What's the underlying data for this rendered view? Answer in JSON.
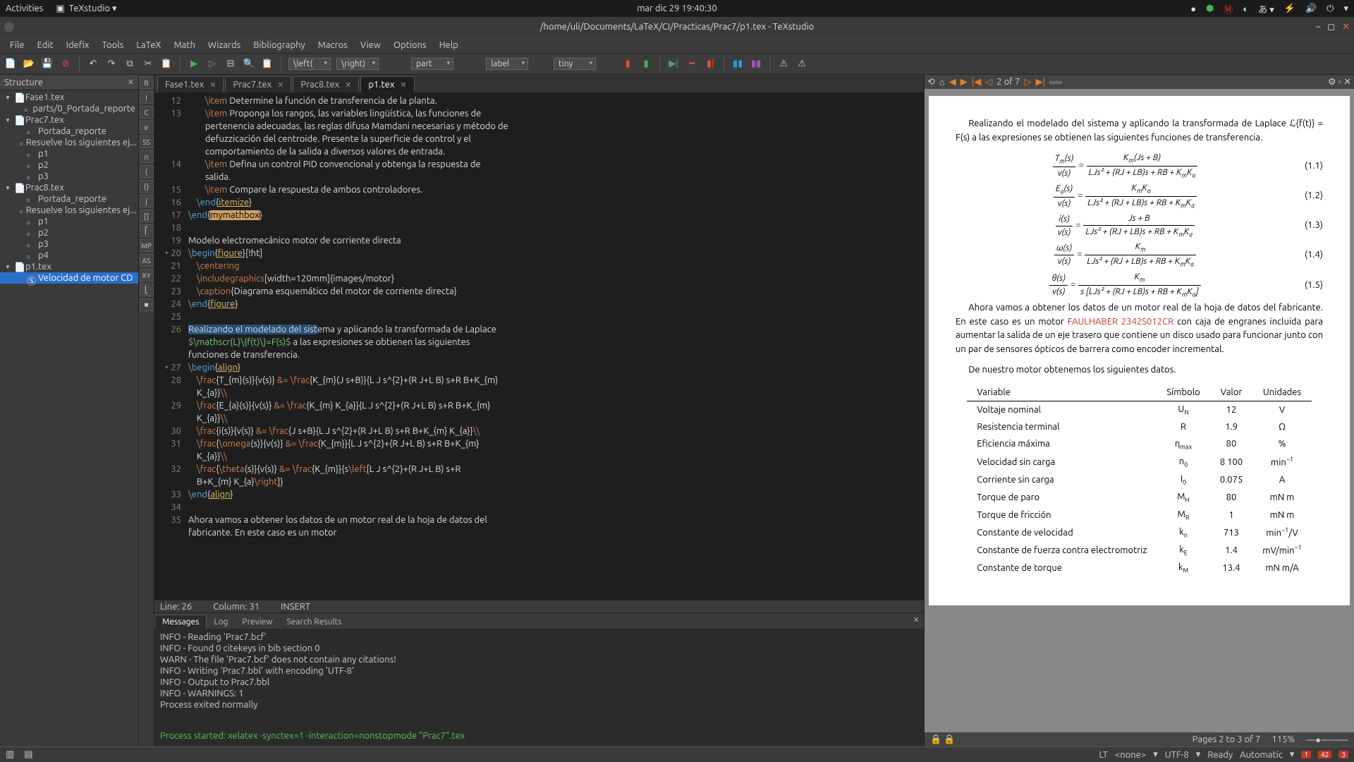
{
  "topbar": {
    "activities": "Activities",
    "app": "TeXstudio",
    "clock": "mar dic 29  19:40:30"
  },
  "titlebar": {
    "path": "/home/uli/Documents/LaTeX/CI/Practicas/Prac7/p1.tex - TeXstudio"
  },
  "menus": [
    "File",
    "Edit",
    "Idefix",
    "Tools",
    "LaTeX",
    "Math",
    "Wizards",
    "Bibliography",
    "Macros",
    "View",
    "Options",
    "Help"
  ],
  "combos": {
    "left": "\\left(",
    "right": "\\right)",
    "part": "part",
    "label": "label",
    "tiny": "tiny"
  },
  "structure": {
    "title": "Structure",
    "tree": [
      {
        "d": 0,
        "t": "▾",
        "label": "Fase1.tex"
      },
      {
        "d": 1,
        "t": "",
        "label": "parts/0_Portada_reporte"
      },
      {
        "d": 0,
        "t": "▾",
        "label": "Prac7.tex"
      },
      {
        "d": 1,
        "t": "",
        "label": "Portada_reporte"
      },
      {
        "d": 1,
        "t": "",
        "label": "Resuelve los siguientes ej..."
      },
      {
        "d": 1,
        "t": "",
        "label": "p1"
      },
      {
        "d": 1,
        "t": "",
        "label": "p2"
      },
      {
        "d": 1,
        "t": "",
        "label": "p3"
      },
      {
        "d": 0,
        "t": "▾",
        "label": "Prac8.tex"
      },
      {
        "d": 1,
        "t": "",
        "label": "Portada_reporte"
      },
      {
        "d": 1,
        "t": "",
        "label": "Resuelve los siguientes ej..."
      },
      {
        "d": 1,
        "t": "",
        "label": "p1"
      },
      {
        "d": 1,
        "t": "",
        "label": "p2"
      },
      {
        "d": 1,
        "t": "",
        "label": "p3"
      },
      {
        "d": 1,
        "t": "",
        "label": "p4"
      },
      {
        "d": 0,
        "t": "▾",
        "label": "p1.tex"
      },
      {
        "d": 1,
        "t": "",
        "label": "Velocidad de motor CD",
        "sel": true
      }
    ]
  },
  "side_icons": [
    "B",
    "I",
    "C",
    "e",
    "SS",
    "π",
    "(",
    "{}",
    "∫",
    "[]",
    "⎡",
    "MP",
    "AS",
    "XY",
    "⎣",
    "■"
  ],
  "tabs": [
    {
      "label": "Fase1.tex"
    },
    {
      "label": "Prac7.tex"
    },
    {
      "label": "Prac8.tex"
    },
    {
      "label": "p1.tex",
      "active": true
    }
  ],
  "gutter": [
    {
      "n": "12"
    },
    {
      "n": "13"
    },
    {
      "n": ""
    },
    {
      "n": ""
    },
    {
      "n": ""
    },
    {
      "n": "14"
    },
    {
      "n": ""
    },
    {
      "n": "15"
    },
    {
      "n": "16"
    },
    {
      "n": "17"
    },
    {
      "n": "18"
    },
    {
      "n": "19"
    },
    {
      "n": "20",
      "f": "▾"
    },
    {
      "n": "21"
    },
    {
      "n": "22"
    },
    {
      "n": "23"
    },
    {
      "n": "24"
    },
    {
      "n": "25"
    },
    {
      "n": "26"
    },
    {
      "n": ""
    },
    {
      "n": ""
    },
    {
      "n": "27",
      "f": "▾"
    },
    {
      "n": "28"
    },
    {
      "n": ""
    },
    {
      "n": "29"
    },
    {
      "n": ""
    },
    {
      "n": "30"
    },
    {
      "n": "31"
    },
    {
      "n": ""
    },
    {
      "n": "32"
    },
    {
      "n": ""
    },
    {
      "n": "33"
    },
    {
      "n": "34"
    },
    {
      "n": "35"
    },
    {
      "n": ""
    }
  ],
  "edstatus": {
    "line": "Line: 26",
    "col": "Column: 31",
    "mode": "INSERT"
  },
  "bottom": {
    "tabs": [
      "Messages",
      "Log",
      "Preview",
      "Search Results"
    ],
    "lines": [
      "INFO - Reading 'Prac7.bcf'",
      "INFO - Found 0 citekeys in bib section 0",
      "WARN - The file 'Prac7.bcf' does not contain any citations!",
      "INFO - Writing 'Prac7.bbl' with encoding 'UTF-8'",
      "INFO - Output to Prac7.bbl",
      "INFO - WARNINGS: 1",
      "Process exited normally"
    ],
    "green": "Process started: xelatex -synctex=1 -interaction=nonstopmode \"Prac7\".tex",
    "final": "Process exited normally"
  },
  "preview": {
    "nav": "2  of 7",
    "status_pages": "Pages 2 to 3 of 7",
    "zoom": "115%",
    "p1": "Realizando el modelado del sistema y aplicando la transformada de Laplace ℒ{f(t)} = F(s) a las expresiones se obtienen las siguientes funciones de transferencia.",
    "p2a": "Ahora vamos a obtener los datos de un motor real de la hoja de datos del fabricante. En este caso es un motor ",
    "p2link": "FAULHABER 2342S012CR",
    "p2b": " con caja de engranes incluida para aumentar la salida de un eje trasero que contiene un disco usado para funcionar junto con un par de sensores ópticos de barrera como encoder incremental.",
    "p3": "De nuestro motor obtenemos los siguientes datos.",
    "eqs": [
      {
        "num": "T_m(s)",
        "den": "v(s)",
        "rn": "K_m(Js + B)",
        "rd": "LJs² + (RJ + LB)s + RB + K_mK_a",
        "tag": "(1.1)"
      },
      {
        "num": "E_a(s)",
        "den": "v(s)",
        "rn": "K_mK_a",
        "rd": "LJs² + (RJ + LB)s + RB + K_mK_a",
        "tag": "(1.2)"
      },
      {
        "num": "i(s)",
        "den": "v(s)",
        "rn": "Js + B",
        "rd": "LJs² + (RJ + LB)s + RB + K_mK_a",
        "tag": "(1.3)"
      },
      {
        "num": "ω(s)",
        "den": "v(s)",
        "rn": "K_m",
        "rd": "LJs² + (RJ + LB)s + RB + K_mK_a",
        "tag": "(1.4)"
      },
      {
        "num": "θ(s)",
        "den": "v(s)",
        "rn": "K_m",
        "rd": "s [LJs² + (RJ + LB)s + RB + K_mK_a]",
        "tag": "(1.5)"
      }
    ],
    "table": {
      "head": [
        "Variable",
        "Símbolo",
        "Valor",
        "Unidades"
      ],
      "rows": [
        [
          "Voltaje nominal",
          "U_N",
          "12",
          "V"
        ],
        [
          "Resistencia terminal",
          "R",
          "1.9",
          "Ω"
        ],
        [
          "Eficiencia máxima",
          "η_max",
          "80",
          "%"
        ],
        [
          "Velocidad sin carga",
          "n_0",
          "8 100",
          "min⁻¹"
        ],
        [
          "Corriente sin carga",
          "I_0",
          "0.075",
          "A"
        ],
        [
          "Torque de paro",
          "M_H",
          "80",
          "mN m"
        ],
        [
          "Torque de fricción",
          "M_R",
          "1",
          "mN m"
        ],
        [
          "Constante de velocidad",
          "k_n",
          "713",
          "min⁻¹/V"
        ],
        [
          "Constante de fuerza contra electromotriz",
          "k_E",
          "1.4",
          "mV/min⁻¹"
        ],
        [
          "Constante de torque",
          "k_M",
          "13.4",
          "mN m/A"
        ]
      ]
    }
  },
  "status": {
    "lt": "LT",
    "enc": "<none>",
    "utf": "UTF-8",
    "ready": "Ready",
    "auto": "Automatic",
    "b1": "1",
    "b2": "42",
    "b3": "3"
  }
}
